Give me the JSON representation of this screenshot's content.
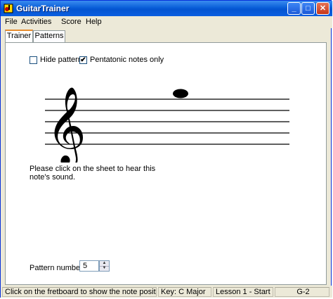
{
  "window": {
    "title": "GuitarTrainer",
    "minimize_glyph": "_",
    "maximize_glyph": "□",
    "close_glyph": "✕"
  },
  "menu": [
    "File",
    "Activities",
    "Score",
    "Help"
  ],
  "tabs": [
    {
      "label": "Trainer",
      "active": true
    },
    {
      "label": "Patterns",
      "active": false
    }
  ],
  "options": {
    "hide_pattern": {
      "label": "Hide pattern",
      "checked": false
    },
    "pentatonic": {
      "label": "Pentatonic notes only",
      "checked": true
    }
  },
  "instruction": "Please click on the sheet to hear this note's sound.",
  "pattern": {
    "label": "Pattern number:",
    "value": "5"
  },
  "status": {
    "hint": "Click on the fretboard to show the note position.",
    "key": "Key: C Major",
    "lesson": "Lesson 1 - Start",
    "note": "G-2"
  },
  "colors": {
    "pattern_dot": "#1a1aff",
    "note_dot": "#000000",
    "fretboard": "#c8935a"
  }
}
